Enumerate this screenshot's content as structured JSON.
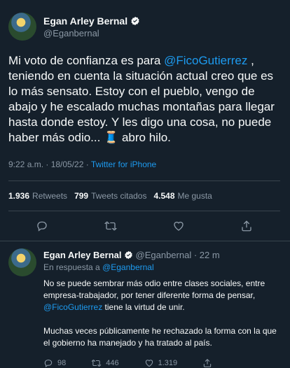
{
  "main_tweet": {
    "author_name": "Egan Arley Bernal",
    "author_handle": "@Eganbernal",
    "text_part1": "Mi voto de confianza es para ",
    "mention": "@FicoGutierrez",
    "text_part2": " , teniendo en cuenta la situación actual creo que es lo más sensato. Estoy con el pueblo, vengo de abajo y he escalado muchas montañas para llegar hasta donde estoy. Y les digo una cosa, no puede haber más odio... ",
    "emoji": "🧵",
    "text_part3": " abro hilo.",
    "time": "9:22 a.m. · 18/05/22 · ",
    "source": "Twitter for iPhone",
    "stats": {
      "retweets_count": "1.936",
      "retweets_label": "Retweets",
      "quotes_count": "799",
      "quotes_label": "Tweets citados",
      "likes_count": "4.548",
      "likes_label": "Me gusta"
    },
    "action_icons": [
      "reply-icon",
      "retweet-icon",
      "like-icon",
      "share-icon"
    ]
  },
  "reply_tweet": {
    "author_name": "Egan Arley Bernal",
    "author_handle": "@Eganbernal · 22 m",
    "in_reply_label": "En respuesta a ",
    "in_reply_mention": "@Eganbernal",
    "para1_part1": "No se puede sembrar más odio entre clases sociales, entre empresa-trabajador, por tener diferente forma de pensar, ",
    "para1_mention": "@FicoGutierrez",
    "para1_part2": " tiene la virtud de unir.",
    "para2": "Muchas veces públicamente he rechazado la forma con la que el gobierno ha manejado y ha tratado al país.",
    "reply_count": "98",
    "retweet_count": "446",
    "like_count": "1.319"
  },
  "colors": {
    "background": "#15202b",
    "text": "#f7f9f9",
    "secondary": "#8b98a5",
    "accent": "#1d9bf0",
    "border": "#38444d"
  }
}
